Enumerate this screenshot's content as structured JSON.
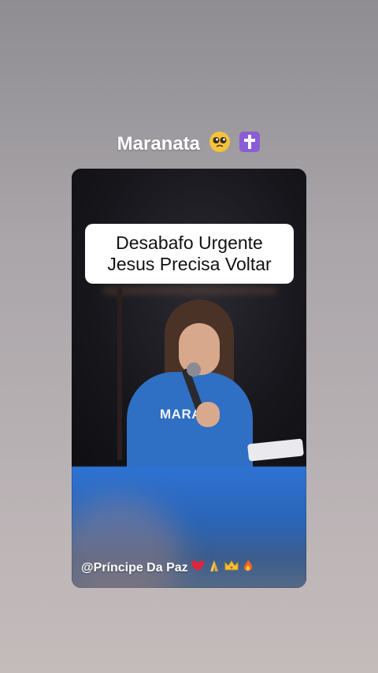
{
  "top_caption": {
    "text": "Maranata",
    "icons": [
      "pleading-face-icon",
      "latin-cross-icon"
    ]
  },
  "video": {
    "overlay_title_line1": "Desabafo Urgente",
    "overlay_title_line2": "Jesus Precisa Voltar",
    "shirt_text": "MARAN",
    "handle_text": "@Príncipe Da Paz",
    "handle_icons": [
      "heart-icon",
      "praying-hands-icon",
      "crown-icon",
      "fire-icon"
    ]
  },
  "colors": {
    "shirt_blue": "#2f6fc4",
    "cross_purple": "#8a5cd6",
    "heart_red": "#e0243a"
  }
}
